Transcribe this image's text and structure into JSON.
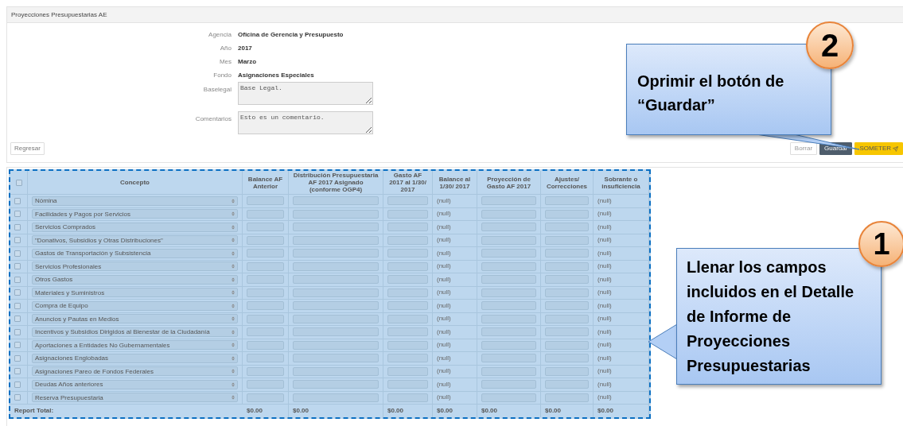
{
  "page_title": "Proyecciones Presupuestarias AE",
  "fields": [
    {
      "label": "Agencia",
      "value": "Oficina de Gerencia y Presupuesto",
      "kind": "text"
    },
    {
      "label": "Año",
      "value": "2017",
      "kind": "text"
    },
    {
      "label": "Mes",
      "value": "Marzo",
      "kind": "text"
    },
    {
      "label": "Fondo",
      "value": "Asignaciones Especiales",
      "kind": "text"
    },
    {
      "label": "Baselegal",
      "value": "Base Legal.",
      "kind": "textarea"
    },
    {
      "label": "Comentarios",
      "value": "Esto es un comentario.",
      "kind": "textarea"
    }
  ],
  "back_button": "Regresar",
  "actions": [
    {
      "label": "Borrar",
      "kind": "default"
    },
    {
      "label": "Guardar",
      "kind": "primary"
    },
    {
      "label": "SOMETER",
      "kind": "warning"
    }
  ],
  "table": {
    "header_checked": false,
    "columns": [
      "Concepto",
      "Balance AF Anterior",
      "Distribución Presupuestaria AF 2017 Asignado (conforme OGP4)",
      "Gasto AF 2017 al 1/30/ 2017",
      "Balance al 1/30/ 2017",
      "Proyección de Gasto AF 2017",
      "Ajustes/ Correcciones",
      "Sobrante o insuficiencia"
    ],
    "rows": [
      {
        "checked": false,
        "concepto": "Nómina",
        "balance": "(null)",
        "sobrante": "(null)"
      },
      {
        "checked": false,
        "concepto": "Facilidades y Pagos por Servicios",
        "balance": "(null)",
        "sobrante": "(null)"
      },
      {
        "checked": false,
        "concepto": "Servicios Comprados",
        "balance": "(null)",
        "sobrante": "(null)"
      },
      {
        "checked": false,
        "concepto": "\"Donativos, Subsidios y Otras Distribuciones\"",
        "balance": "(null)",
        "sobrante": "(null)"
      },
      {
        "checked": false,
        "concepto": "Gastos de Transportación y Subsistencia",
        "balance": "(null)",
        "sobrante": "(null)"
      },
      {
        "checked": false,
        "concepto": "Servicios Profesionales",
        "balance": "(null)",
        "sobrante": "(null)"
      },
      {
        "checked": false,
        "concepto": "Otros Gastos",
        "balance": "(null)",
        "sobrante": "(null)"
      },
      {
        "checked": false,
        "concepto": "Materiales y Suministros",
        "balance": "(null)",
        "sobrante": "(null)"
      },
      {
        "checked": false,
        "concepto": "Compra de Equipo",
        "balance": "(null)",
        "sobrante": "(null)"
      },
      {
        "checked": false,
        "concepto": "Anuncios y Pautas en Medios",
        "balance": "(null)",
        "sobrante": "(null)"
      },
      {
        "checked": false,
        "concepto": "Incentivos y Subsidios Dirigidos al Bienestar de la Ciudadanía",
        "balance": "(null)",
        "sobrante": "(null)"
      },
      {
        "checked": false,
        "concepto": "Aportaciones a Entidades No Gubernamentales",
        "balance": "(null)",
        "sobrante": "(null)"
      },
      {
        "checked": false,
        "concepto": "Asignaciones Englobadas",
        "balance": "(null)",
        "sobrante": "(null)"
      },
      {
        "checked": false,
        "concepto": "Asignaciones Pareo de Fondos Federales",
        "balance": "(null)",
        "sobrante": "(null)"
      },
      {
        "checked": false,
        "concepto": "Deudas Años anteriores",
        "balance": "(null)",
        "sobrante": "(null)"
      },
      {
        "checked": false,
        "concepto": "Reserva Presupuestaria",
        "balance": "(null)",
        "sobrante": "(null)"
      }
    ],
    "total_label": "Report Total:",
    "totals": [
      "$0.00",
      "$0.00",
      "$0.00",
      "$0.00",
      "$0.00",
      "$0.00",
      "$0.00"
    ]
  },
  "callouts": [
    {
      "number": "2",
      "lines": [
        "Oprimir el botón de",
        "“Guardar”"
      ]
    },
    {
      "number": "1",
      "lines": [
        "Llenar los campos",
        "incluidos en el Detalle",
        "de Informe de",
        "Proyecciones",
        "Presupuestarias"
      ]
    }
  ]
}
